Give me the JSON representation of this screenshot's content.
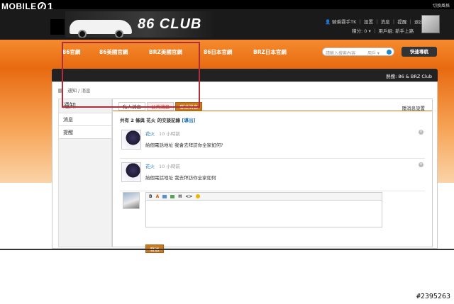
{
  "site": {
    "logo_text": "MOBILE",
    "logo_num": "1",
    "top_right": "切換風格"
  },
  "banner": {
    "title": "86 CLUB"
  },
  "user": {
    "name": "騎乘霧手TK",
    "links": "｜ 設置 ｜ 消息 ｜ 提醒 ｜ 退出",
    "points": "積分: 0 ▾",
    "group": "｜ 用戶組: 新手上路"
  },
  "nav": [
    "86官網",
    "86美國官網",
    "BRZ美國官網",
    "86日本官網",
    "BRZ日本官網"
  ],
  "search": {
    "placeholder": "請輸入搜索內容",
    "scope": "用戶 ▾"
  },
  "quick_nav": "快速導航",
  "hot": "熱搜:  86 & BRZ Club",
  "breadcrumb": {
    "a": "通知",
    "sep": "/",
    "b": "消息"
  },
  "sidebar": {
    "title": "通知",
    "items": [
      "消息",
      "提醒"
    ]
  },
  "tabs": {
    "private": "私人消息",
    "public": "公共消息",
    "send": "發送消息",
    "settings": "隱消息設置"
  },
  "summary": {
    "text": "共有 2 條與 花火 的交談記錄",
    "export": "[導出]"
  },
  "messages": [
    {
      "user": "花火",
      "time": "10 小時前",
      "text": "給個電話地址 我會去拜訪你全家如何?"
    },
    {
      "user": "花火",
      "time": "10 小時前",
      "text": "給個電話地址 我去拜訪你全家如何"
    }
  ],
  "editor": {
    "tools": [
      "B",
      "A",
      "",
      "",
      "H",
      "<>",
      ""
    ]
  },
  "send_label": "發送",
  "watermark": "#2395263",
  "colors": {
    "orange": "#e86a10",
    "highlight": "#b22d3a",
    "link": "#1e6fb5",
    "button": "#c97a1f"
  }
}
